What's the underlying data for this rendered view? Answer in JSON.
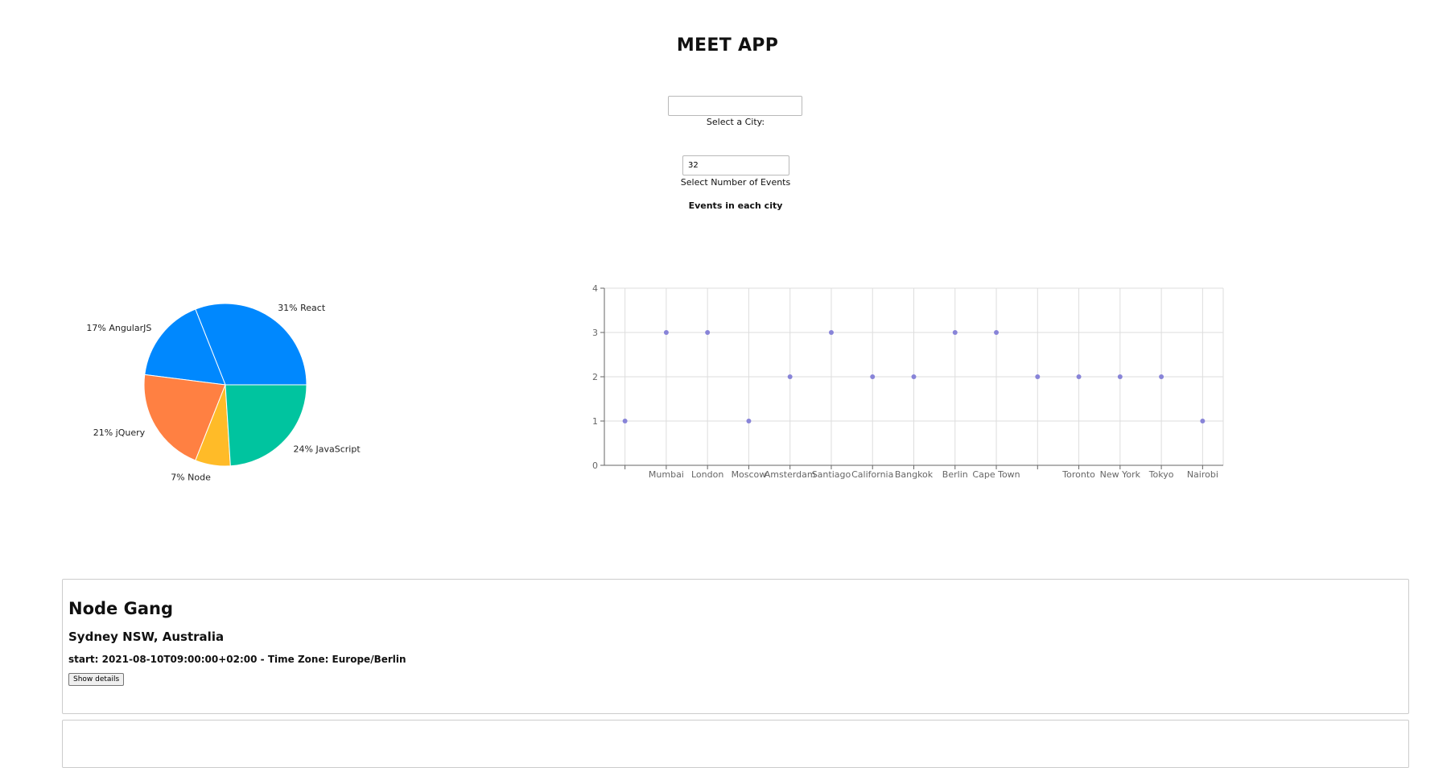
{
  "app": {
    "title": "MEET APP"
  },
  "city_search": {
    "value": "",
    "placeholder": "",
    "label": "Select a City:"
  },
  "number_of_events": {
    "value": "32",
    "label": "Select Number of Events"
  },
  "chart_section": {
    "heading": "Events in each city"
  },
  "chart_data": [
    {
      "type": "pie",
      "slices": [
        {
          "label": "React",
          "percent": 31,
          "color": "#0088FE"
        },
        {
          "label": "AngularJS",
          "percent": 17,
          "color": "#0088FE"
        },
        {
          "label": "jQuery",
          "percent": 21,
          "color": "#FF8042"
        },
        {
          "label": "Node",
          "percent": 7,
          "color": "#FFBB28"
        },
        {
          "label": "JavaScript",
          "percent": 24,
          "color": "#00C49F"
        }
      ]
    },
    {
      "type": "scatter",
      "color": "#8884d8",
      "grid": true,
      "ylim": [
        0,
        4
      ],
      "yticks": [
        0,
        1,
        2,
        3,
        4
      ],
      "categories": [
        "",
        "Mumbai",
        "London",
        "Moscow",
        "Amsterdam",
        "Santiago",
        "California",
        "Bangkok",
        "Berlin",
        "Cape Town",
        "",
        "Toronto",
        "New York",
        "Tokyo",
        "Nairobi"
      ],
      "values": [
        1,
        3,
        3,
        1,
        2,
        3,
        2,
        2,
        3,
        3,
        2,
        2,
        2,
        2,
        1
      ]
    }
  ],
  "events": [
    {
      "summary": "Node Gang",
      "location": "Sydney NSW, Australia",
      "start_text": "start: 2021-08-10T09:00:00+02:00 - Time Zone: Europe/Berlin",
      "button_label": "Show details"
    },
    {
      "summary": "",
      "location": "",
      "start_text": "",
      "button_label": ""
    }
  ]
}
